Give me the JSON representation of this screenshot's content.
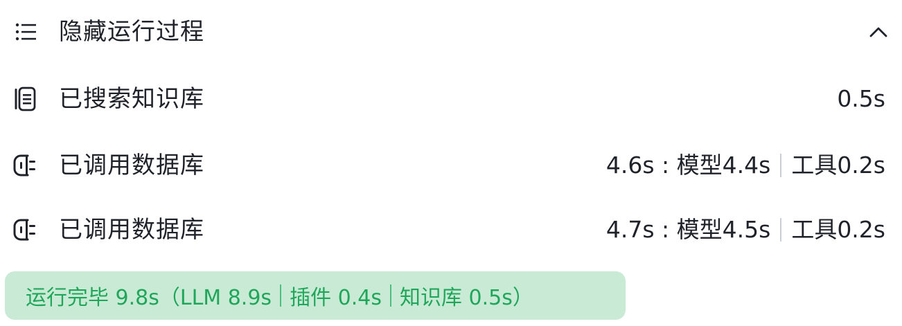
{
  "header": {
    "title": "隐藏运行过程",
    "icon": "list-icon",
    "toggle_icon": "chevron-up-icon"
  },
  "steps": [
    {
      "icon": "document-icon",
      "label": "已搜索知识库",
      "time": "0.5s"
    },
    {
      "icon": "database-plug-icon",
      "label": "已调用数据库",
      "time": "4.6s : 模型4.4s",
      "tool_time": "工具0.2s"
    },
    {
      "icon": "database-plug-icon",
      "label": "已调用数据库",
      "time": "4.7s : 模型4.5s",
      "tool_time": "工具0.2s"
    }
  ],
  "summary": {
    "part1": "运行完毕 9.8s（LLM 8.9s",
    "part2": "插件 0.4s",
    "part3": "知识库 0.5s）",
    "color": "#20a65a",
    "background": "#c9ebd6"
  }
}
